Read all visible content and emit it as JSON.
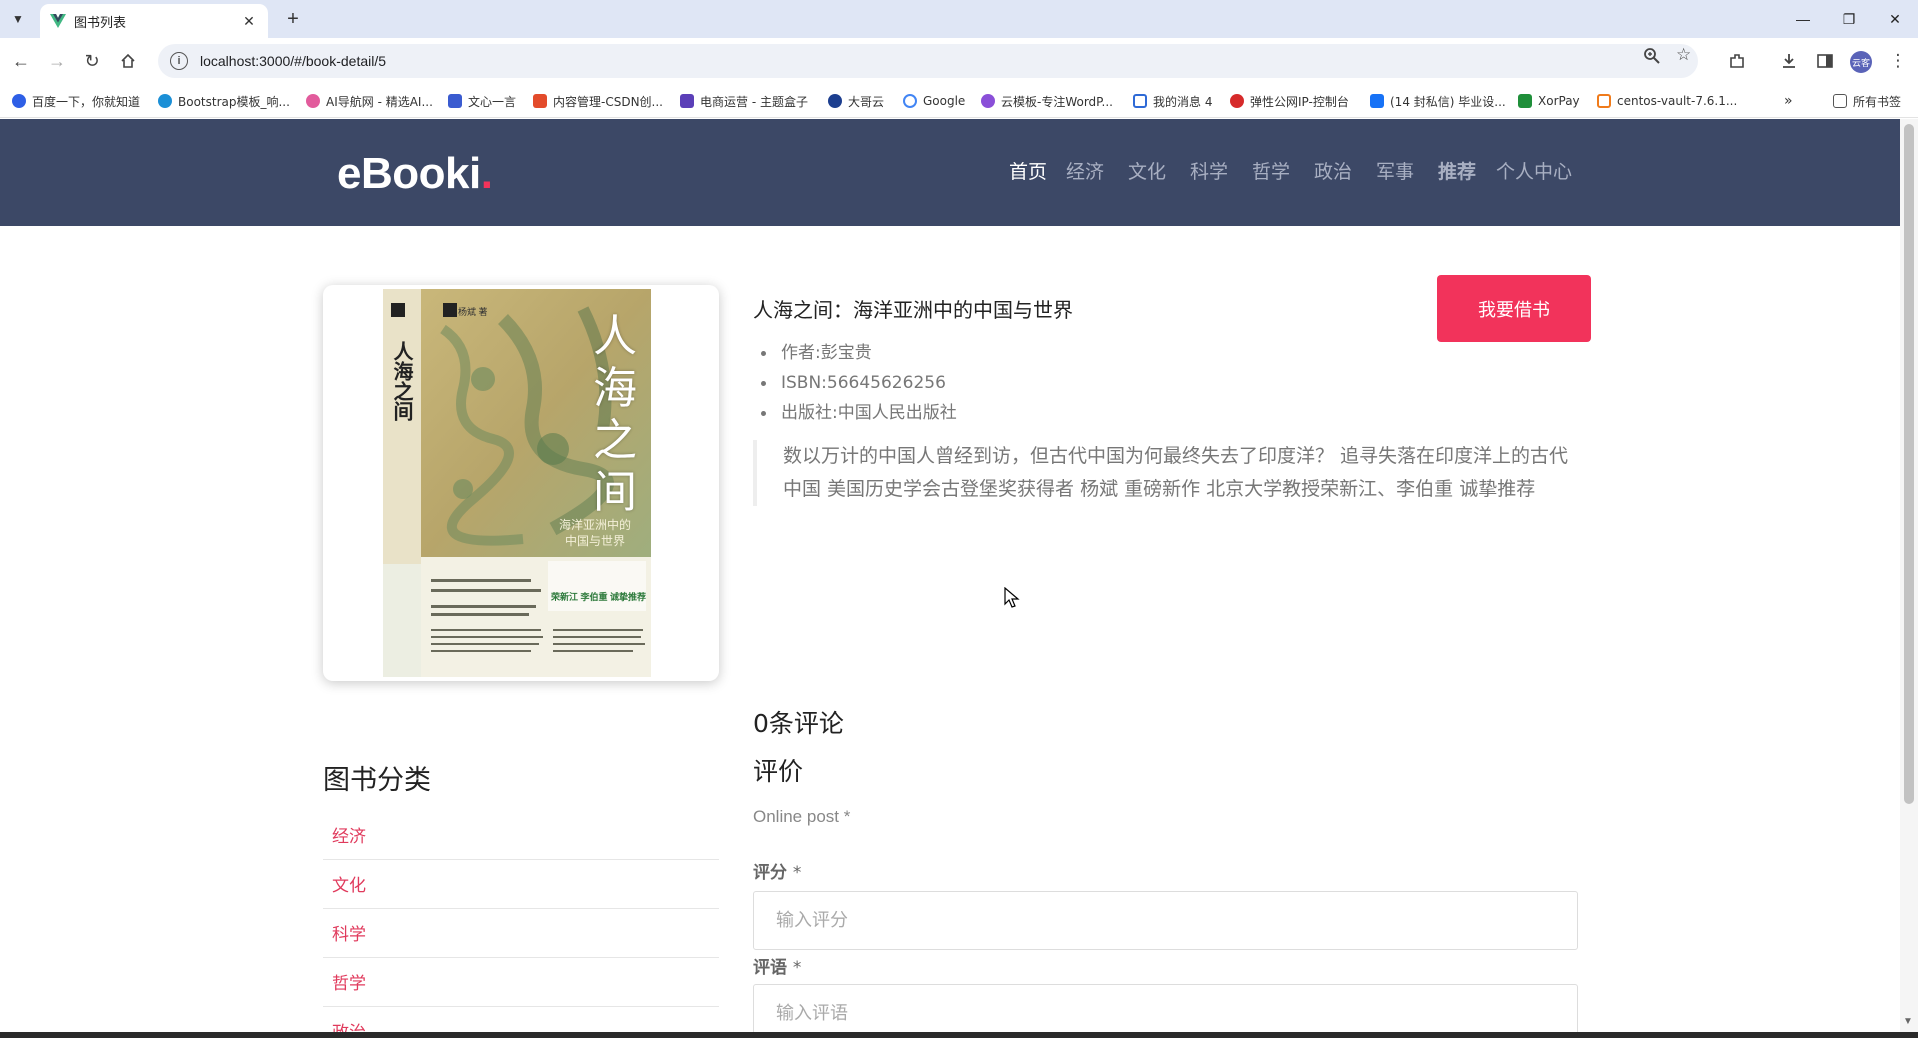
{
  "browser": {
    "tab_title": "图书列表",
    "url": "localhost:3000/#/book-detail/5",
    "profile_label": "云客",
    "bookmarks": [
      "百度一下，你就知道",
      "Bootstrap模板_响...",
      "AI导航网 - 精选AI...",
      "文心一言",
      "内容管理-CSDN创...",
      "电商运营 - 主题盒子",
      "大哥云",
      "Google",
      "云模板-专注WordP...",
      "我的消息 4",
      "弹性公网IP-控制台",
      "(14 封私信) 毕业设...",
      "XorPay",
      "centos-vault-7.6.1..."
    ],
    "all_bookmarks_label": "所有书签"
  },
  "site": {
    "logo_text": "eBooki",
    "logo_dot": ".",
    "nav": [
      "首页",
      "经济",
      "文化",
      "科学",
      "哲学",
      "政治",
      "军事",
      "推荐",
      "个人中心"
    ]
  },
  "book": {
    "title": "人海之间：海洋亚洲中的中国与世界",
    "author": "作者:彭宝贵",
    "isbn": "ISBN:56645626256",
    "publisher": "出版社:中国人民出版社",
    "description": "数以万计的中国人曾经到访，但古代中国为何最终失去了印度洋？ 追寻失落在印度洋上的古代中国 美国历史学会古登堡奖获得者 杨斌 重磅新作 北京大学教授荣新江、李伯重 诚挚推荐",
    "borrow_label": "我要借书",
    "cover": {
      "title_chars": [
        "人",
        "海",
        "之",
        "间"
      ],
      "subtitle_lines": [
        "海洋亚洲中的",
        "中国与世界"
      ],
      "author": "杨斌 著",
      "side_title": "人海之间",
      "recommenders": "荣新江 李伯重 诚挚推荐"
    }
  },
  "comments": {
    "count_label": "0条评论",
    "heading": "评价",
    "online_post": "Online post *",
    "rating_label": "评分",
    "rating_placeholder": "输入评分",
    "comment_label": "评语",
    "comment_placeholder": "输入评语",
    "required_mark": "*"
  },
  "categories": {
    "heading": "图书分类",
    "items": [
      "经济",
      "文化",
      "科学",
      "哲学",
      "政治"
    ]
  }
}
